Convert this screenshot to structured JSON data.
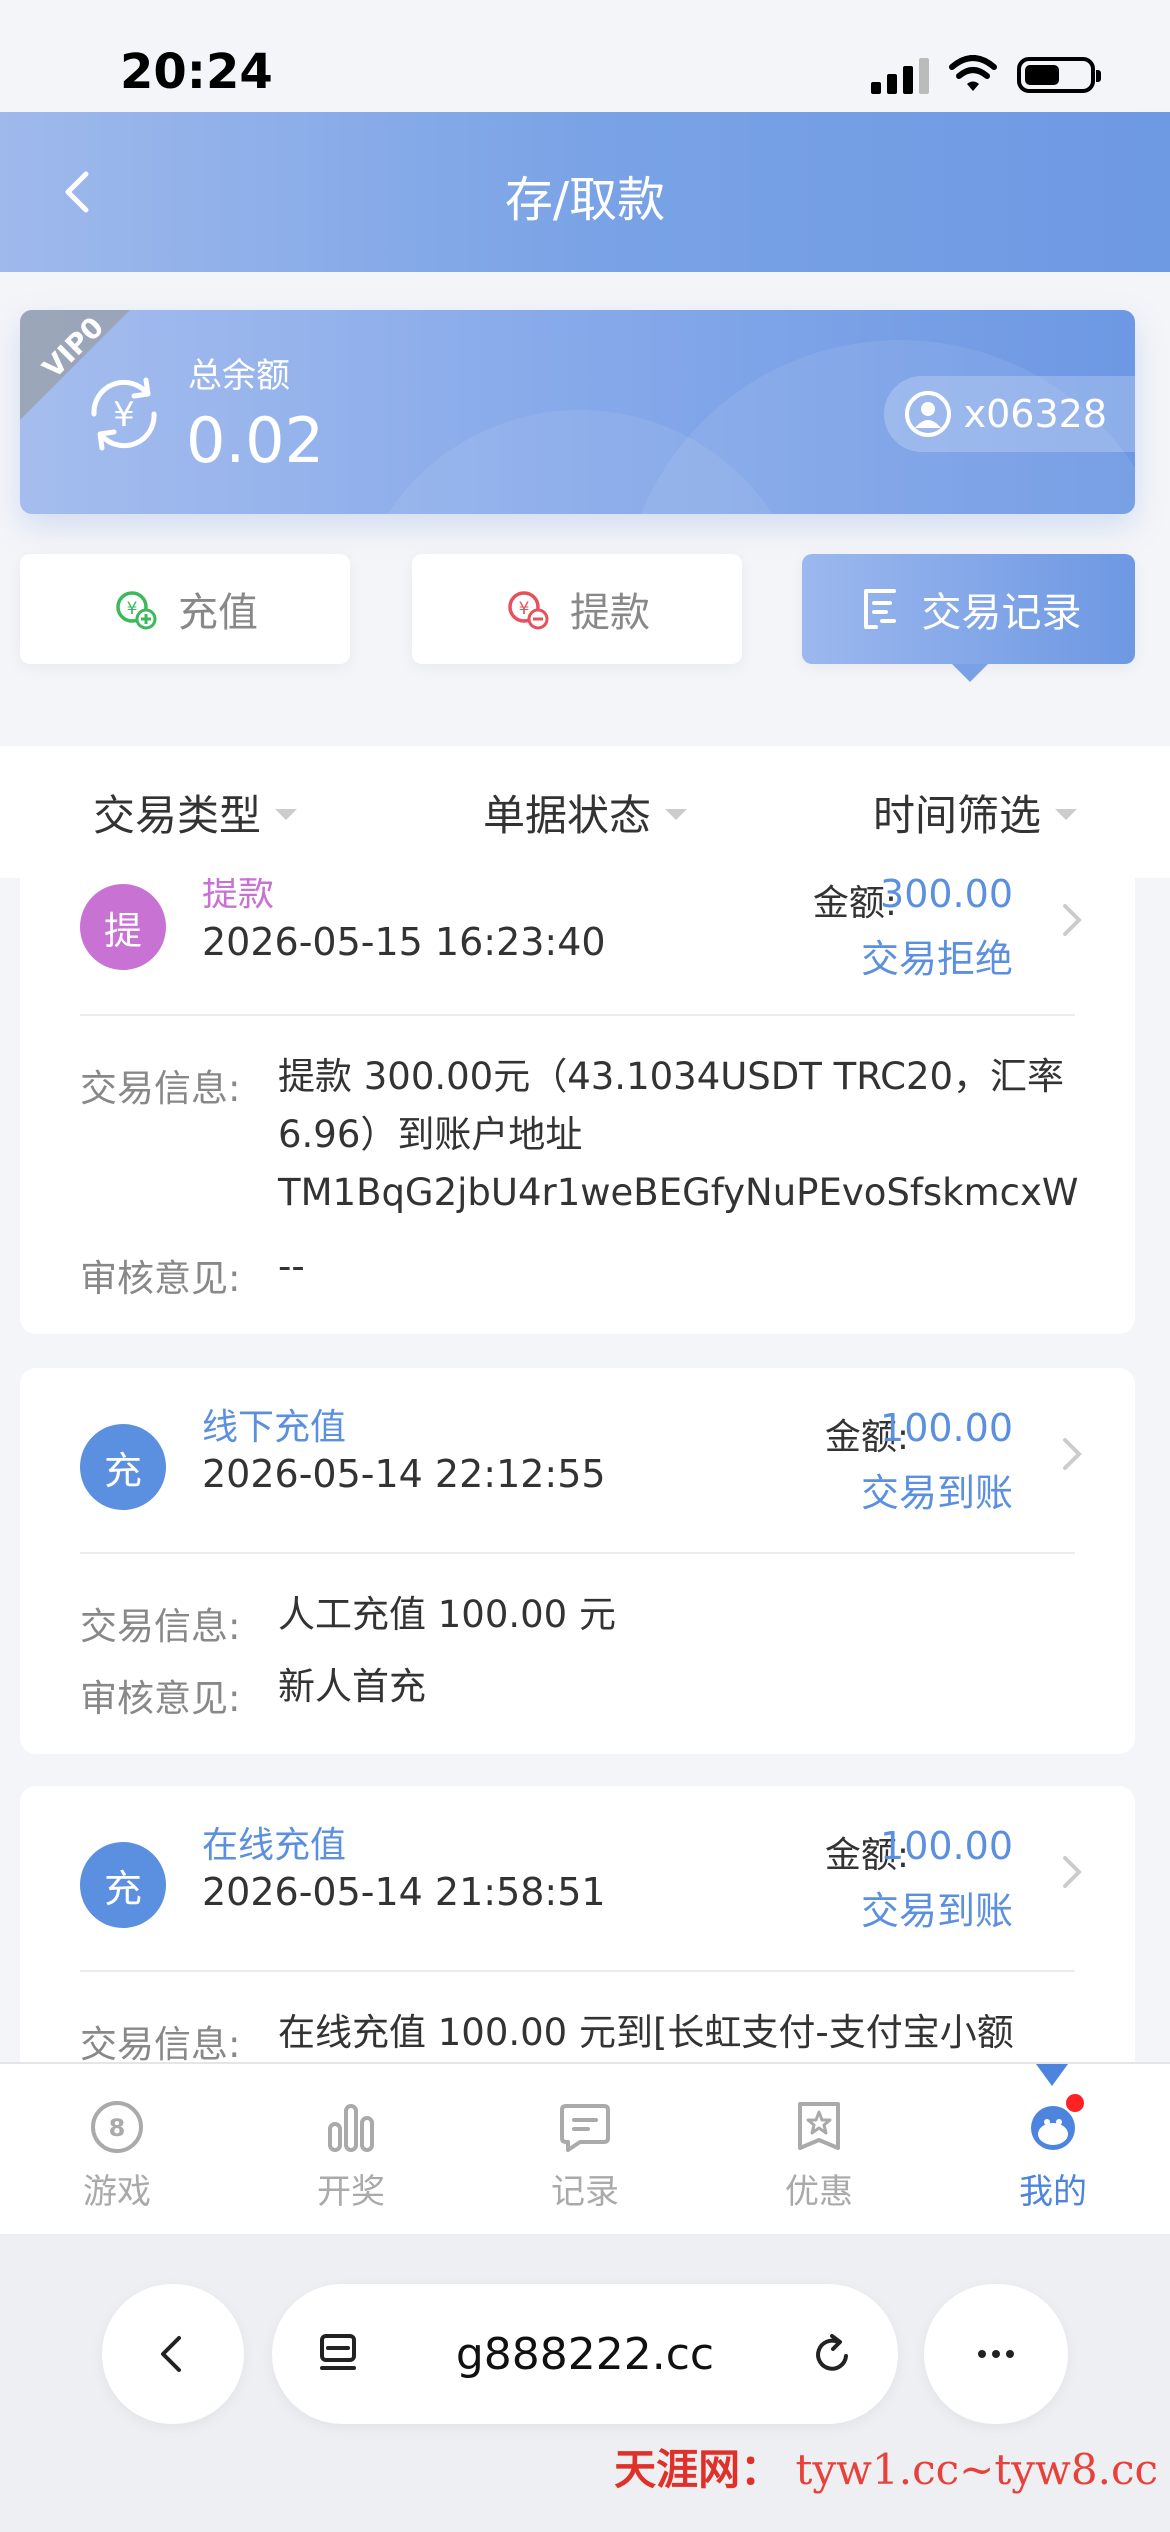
{
  "status_bar": {
    "time": "20:24"
  },
  "header": {
    "title": "存/取款"
  },
  "balance": {
    "vip_label": "VIP0",
    "label": "总余额",
    "value": "0.02",
    "username": "x06328"
  },
  "actions": [
    {
      "label": "充值"
    },
    {
      "label": "提款"
    },
    {
      "label": "交易记录"
    }
  ],
  "filters": [
    {
      "label": "交易类型"
    },
    {
      "label": "单据状态"
    },
    {
      "label": "时间筛选"
    }
  ],
  "transactions": [
    {
      "badge": "提",
      "type": "提款",
      "datetime": "2026-05-15 16:23:40",
      "amount_label": "金额:",
      "amount": "300.00",
      "status": "交易拒绝",
      "info_label": "交易信息:",
      "info": "提款 300.00元（43.1034USDT TRC20，汇率6.96）到账户地址TM1BqG2jbU4r1weBEGfyNuPEvoSfskmcxW",
      "review_label": "审核意见:",
      "review": "--"
    },
    {
      "badge": "充",
      "type": "线下充值",
      "datetime": "2026-05-14 22:12:55",
      "amount_label": "金额:",
      "amount": "100.00",
      "status": "交易到账",
      "info_label": "交易信息:",
      "info": "人工充值 100.00 元",
      "review_label": "审核意见:",
      "review": "新人首充"
    },
    {
      "badge": "充",
      "type": "在线充值",
      "datetime": "2026-05-14 21:58:51",
      "amount_label": "金额:",
      "amount": "100.00",
      "status": "交易到账",
      "info_label": "交易信息:",
      "info": "在线充值 100.00 元到[长虹支付-支付宝小额"
    }
  ],
  "tabbar": [
    {
      "label": "游戏"
    },
    {
      "label": "开奖"
    },
    {
      "label": "记录"
    },
    {
      "label": "优惠"
    },
    {
      "label": "我的"
    }
  ],
  "browser": {
    "url": "g888222.cc"
  },
  "watermark": {
    "site": "天涯网：",
    "urls": "tyw1.cc~tyw8.cc"
  },
  "colors": {
    "accent": "#6d98e3",
    "badge_withdraw": "#c872d4",
    "badge_deposit": "#5b8fdf",
    "status_rejected": "#5b8fdf",
    "tab_active": "#4d84de"
  }
}
